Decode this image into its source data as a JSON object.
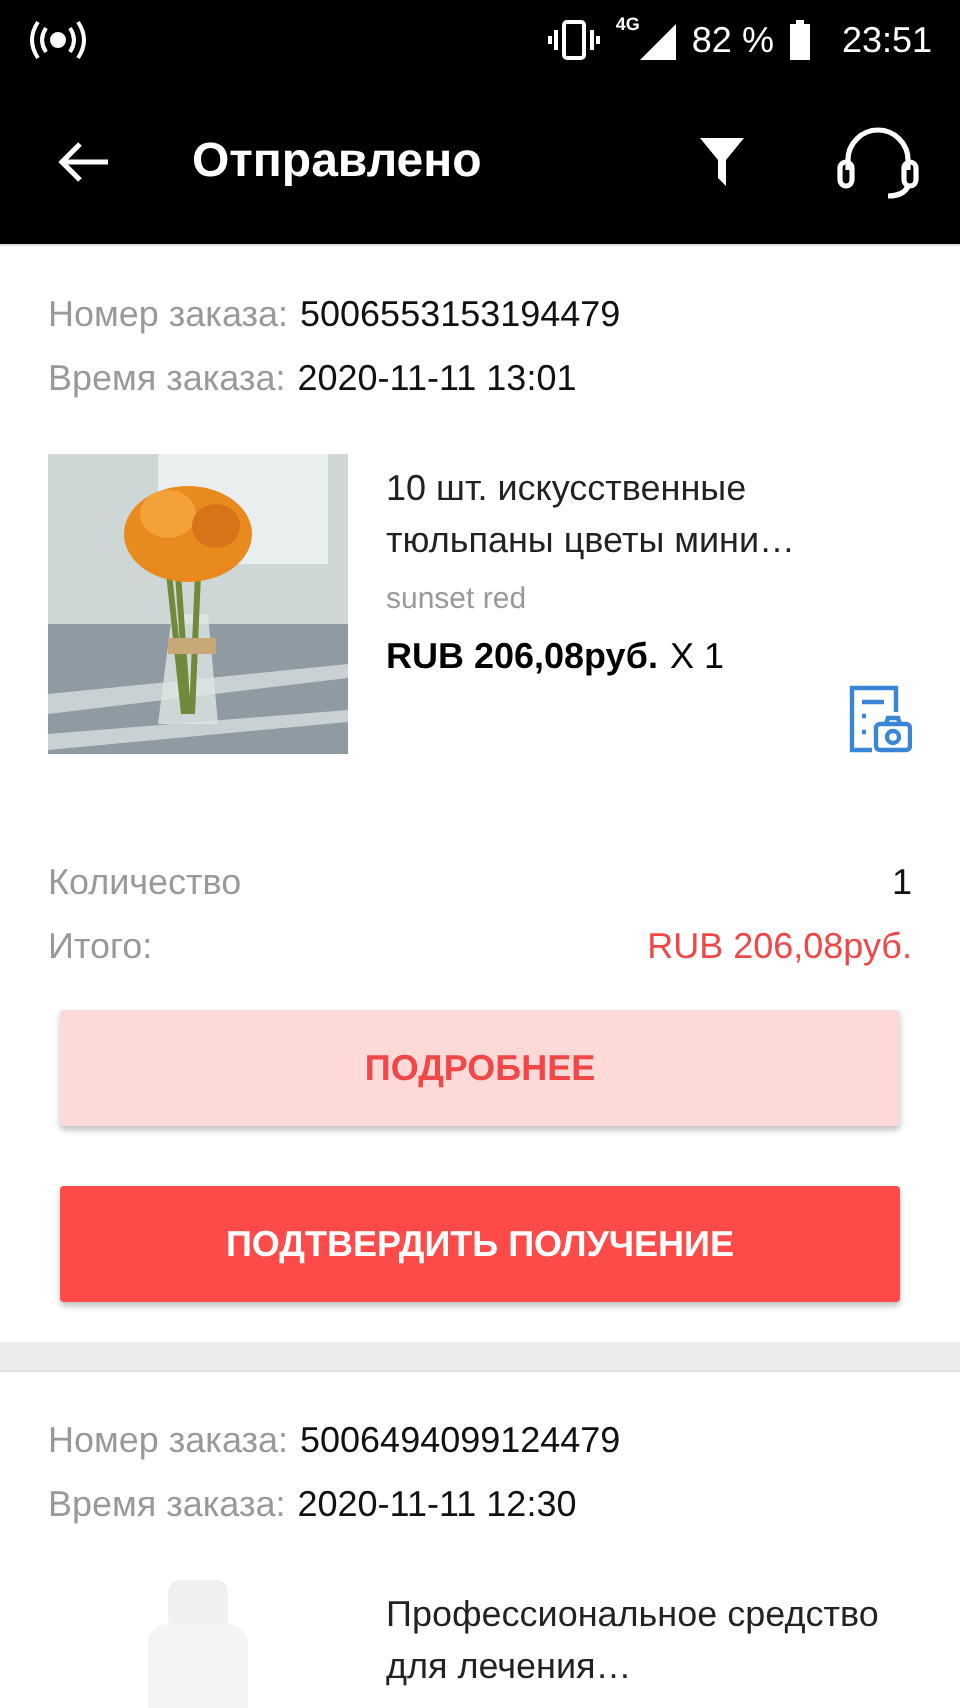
{
  "status_bar": {
    "network": "4G",
    "battery": "82 %",
    "time": "23:51"
  },
  "app_bar": {
    "title": "Отправлено"
  },
  "orders": [
    {
      "number_label": "Номер заказа:",
      "number": "5006553153194479",
      "time_label": "Время заказа:",
      "time": "2020-11-11 13:01",
      "product": {
        "title": "10 шт. искусственные тюльпаны цветы мини…",
        "variant": "sunset red",
        "price": "RUB 206,08руб.",
        "quantity": "X 1",
        "kind": "flowers"
      },
      "summary": [
        {
          "label": "Количество",
          "value": "1",
          "kind": "plain"
        },
        {
          "label": "Итого:",
          "value": "RUB 206,08руб.",
          "kind": "total"
        }
      ],
      "buttons": [
        {
          "label": "ПОДРОБНЕЕ",
          "kind": "secondary"
        },
        {
          "label": "ПОДТВЕРДИТЬ ПОЛУЧЕНИЕ",
          "kind": "primary"
        }
      ]
    },
    {
      "number_label": "Номер заказа:",
      "number": "5006494099124479",
      "time_label": "Время заказа:",
      "time": "2020-11-11 12:30",
      "product": {
        "title": "Профессиональное средство для лечения…",
        "kind": "bottle"
      }
    }
  ]
}
